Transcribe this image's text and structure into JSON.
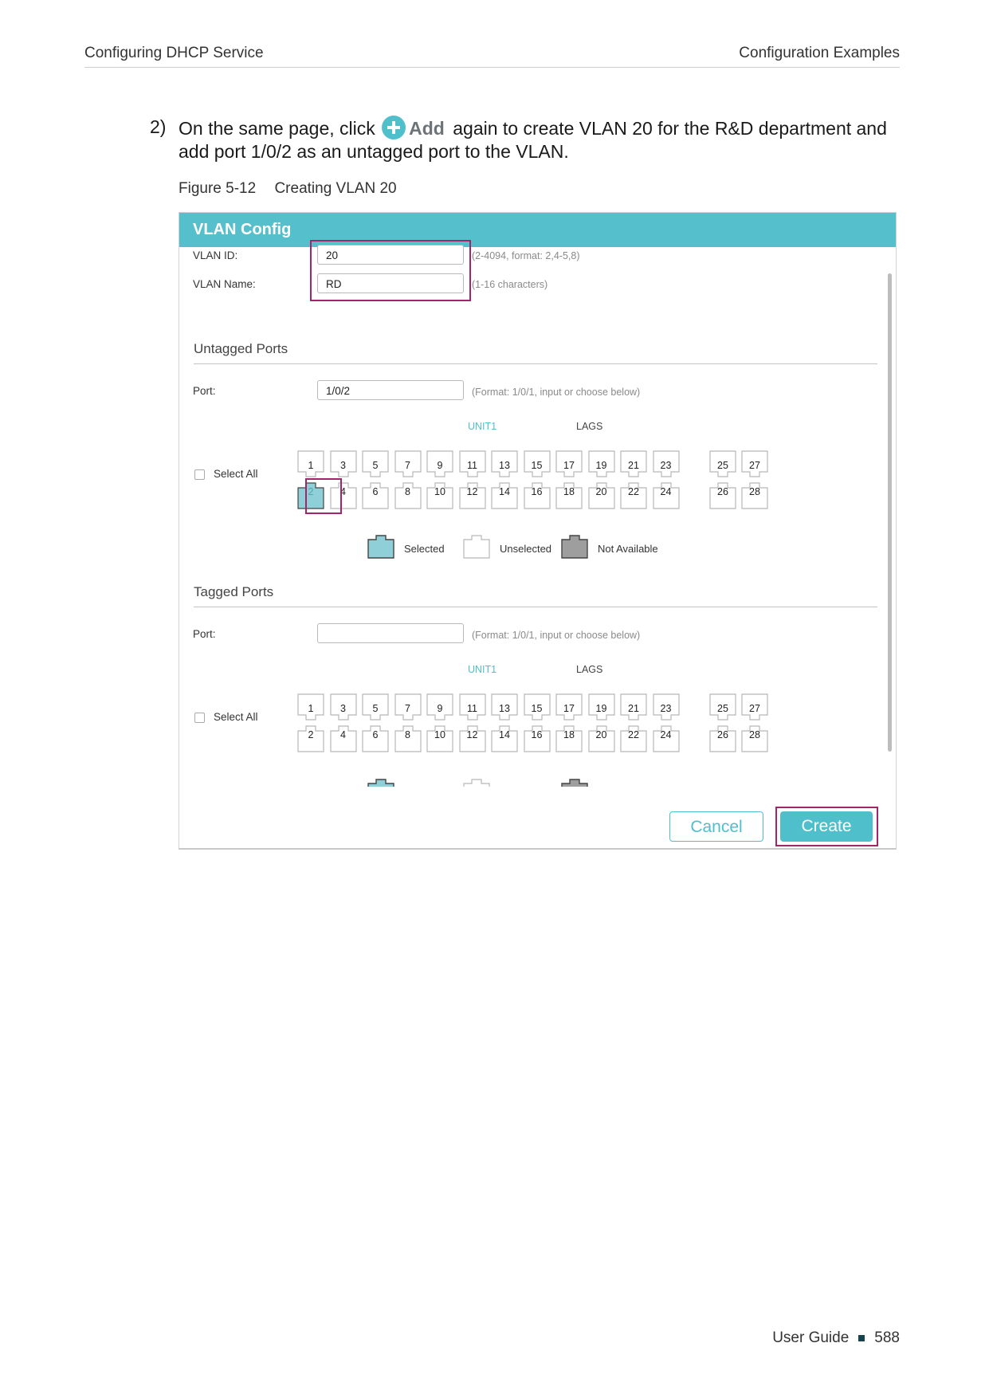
{
  "header": {
    "left": "Configuring DHCP Service",
    "right": "Configuration Examples"
  },
  "step": {
    "number": "2)",
    "text_before": "On the same page, click",
    "add_label": "Add",
    "text_after": "again to create VLAN 20 for the R&D department and add port 1/0/2 as an untagged port to the VLAN."
  },
  "caption": {
    "figure": "Figure 5-12",
    "title": "Creating VLAN 20"
  },
  "dialog": {
    "title": "VLAN Config",
    "vlan_id_label": "VLAN ID:",
    "vlan_id_value": "20",
    "vlan_id_hint": "(2-4094, format: 2,4-5,8)",
    "vlan_name_label": "VLAN Name:",
    "vlan_name_value": "RD",
    "vlan_name_hint": "(1-16 characters)",
    "untagged": {
      "title": "Untagged Ports",
      "port_label": "Port:",
      "port_value": "1/0/2",
      "port_hint": "(Format: 1/0/1, input or choose below)",
      "unit_label": "UNIT1",
      "lags_label": "LAGS",
      "select_all": "Select All",
      "selected_ports": [
        "2"
      ]
    },
    "tagged": {
      "title": "Tagged Ports",
      "port_label": "Port:",
      "port_value": "",
      "port_hint": "(Format: 1/0/1, input or choose below)",
      "unit_label": "UNIT1",
      "lags_label": "LAGS",
      "select_all": "Select All",
      "selected_ports": []
    },
    "ports_top": [
      "1",
      "3",
      "5",
      "7",
      "9",
      "11",
      "13",
      "15",
      "17",
      "19",
      "21",
      "23"
    ],
    "ports_bottom": [
      "2",
      "4",
      "6",
      "8",
      "10",
      "12",
      "14",
      "16",
      "18",
      "20",
      "22",
      "24"
    ],
    "lags_top": [
      "25",
      "27"
    ],
    "lags_bottom": [
      "26",
      "28"
    ],
    "legend": {
      "selected": "Selected",
      "unselected": "Unselected",
      "not_available": "Not Available"
    },
    "colors": {
      "accent": "#55bfcb",
      "highlight": "#a32468",
      "selected_fill": "#8fd0d8",
      "unavailable_fill": "#9e9e9e"
    },
    "cancel_label": "Cancel",
    "create_label": "Create"
  },
  "footer": {
    "label": "User Guide",
    "page": "588"
  }
}
